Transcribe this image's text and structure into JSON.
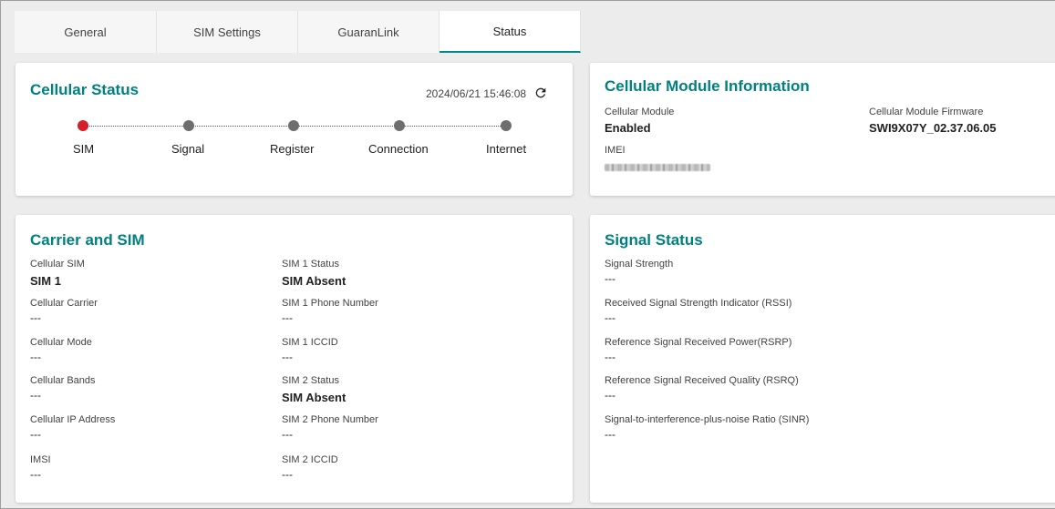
{
  "tabs": [
    {
      "label": "General"
    },
    {
      "label": "SIM Settings"
    },
    {
      "label": "GuaranLink"
    },
    {
      "label": "Status",
      "active": true
    }
  ],
  "cellular_status": {
    "title": "Cellular Status",
    "timestamp": "2024/06/21 15:46:08",
    "refresh_icon": "refresh-icon",
    "steps": [
      {
        "label": "SIM",
        "state": "error",
        "color": "#d32029"
      },
      {
        "label": "Signal",
        "state": "inactive",
        "color": "#6e6e6e"
      },
      {
        "label": "Register",
        "state": "inactive",
        "color": "#6e6e6e"
      },
      {
        "label": "Connection",
        "state": "inactive",
        "color": "#6e6e6e"
      },
      {
        "label": "Internet",
        "state": "inactive",
        "color": "#6e6e6e"
      }
    ]
  },
  "module_info": {
    "title": "Cellular Module Information",
    "module_label": "Cellular Module",
    "module_value": "Enabled",
    "firmware_label": "Cellular Module Firmware",
    "firmware_value": "SWI9X07Y_02.37.06.05",
    "imei_label": "IMEI"
  },
  "carrier_sim": {
    "title": "Carrier and SIM",
    "left": [
      {
        "label": "Cellular SIM",
        "value": "SIM 1",
        "bold": true
      },
      {
        "label": "Cellular Carrier",
        "value": "---"
      },
      {
        "label": "Cellular Mode",
        "value": "---"
      },
      {
        "label": "Cellular Bands",
        "value": "---"
      },
      {
        "label": "Cellular IP Address",
        "value": "---"
      },
      {
        "label": "IMSI",
        "value": "---"
      }
    ],
    "right": [
      {
        "label": "SIM 1 Status",
        "value": "SIM Absent",
        "bold": true
      },
      {
        "label": "SIM 1 Phone Number",
        "value": "---"
      },
      {
        "label": "SIM 1 ICCID",
        "value": "---"
      },
      {
        "label": "SIM 2 Status",
        "value": "SIM Absent",
        "bold": true
      },
      {
        "label": "SIM 2 Phone Number",
        "value": "---"
      },
      {
        "label": "SIM 2 ICCID",
        "value": "---"
      }
    ]
  },
  "signal_status": {
    "title": "Signal Status",
    "items": [
      {
        "label": "Signal Strength",
        "value": "---"
      },
      {
        "label": "Received Signal Strength Indicator (RSSI)",
        "value": "---"
      },
      {
        "label": "Reference Signal Received Power(RSRP)",
        "value": "---"
      },
      {
        "label": "Reference Signal Received Quality (RSRQ)",
        "value": "---"
      },
      {
        "label": "Signal-to-interference-plus-noise Ratio (SINR)",
        "value": "---"
      }
    ]
  },
  "colors": {
    "accent": "#008080",
    "active_tab_underline": "#008a8e",
    "error_dot": "#d32029",
    "inactive_dot": "#6e6e6e"
  }
}
